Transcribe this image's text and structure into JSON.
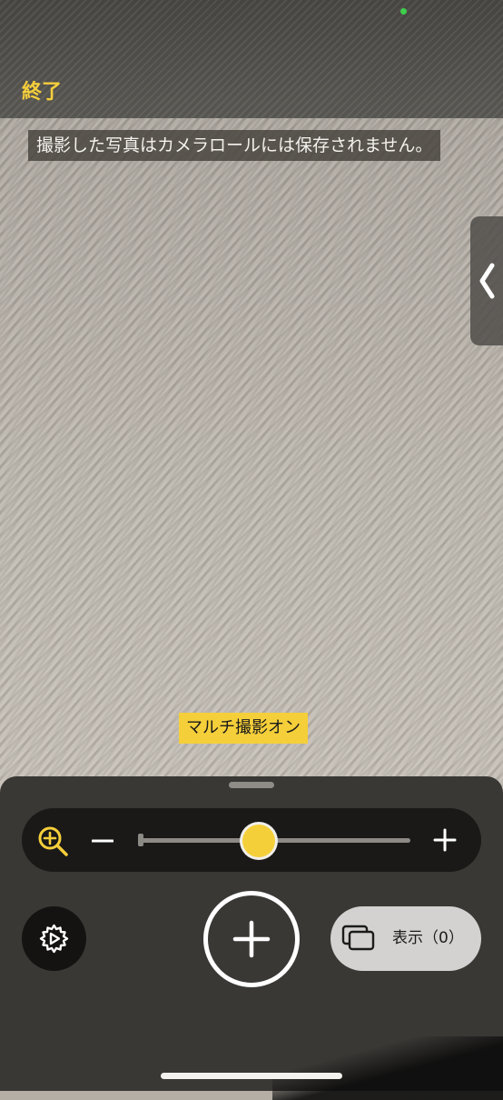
{
  "header": {
    "done_label": "終了"
  },
  "notice": {
    "camera_roll": "撮影した写真はカメラロールには保存されません。"
  },
  "multi_capture": {
    "label": "マルチ撮影オン"
  },
  "zoom": {
    "level_fraction": 0.44
  },
  "controls": {
    "view_label": "表示（0）"
  },
  "icons": {
    "zoom": "magnifier-plus-icon",
    "minus": "minus-icon",
    "plus": "plus-icon",
    "settings": "gear-play-icon",
    "capture": "plus-icon",
    "view": "stacked-photos-icon",
    "side_tab": "chevron-left-icon"
  },
  "colors": {
    "accent": "#f5cf3a",
    "panel": "#3a3835",
    "status_dot": "#3ecf4d"
  }
}
